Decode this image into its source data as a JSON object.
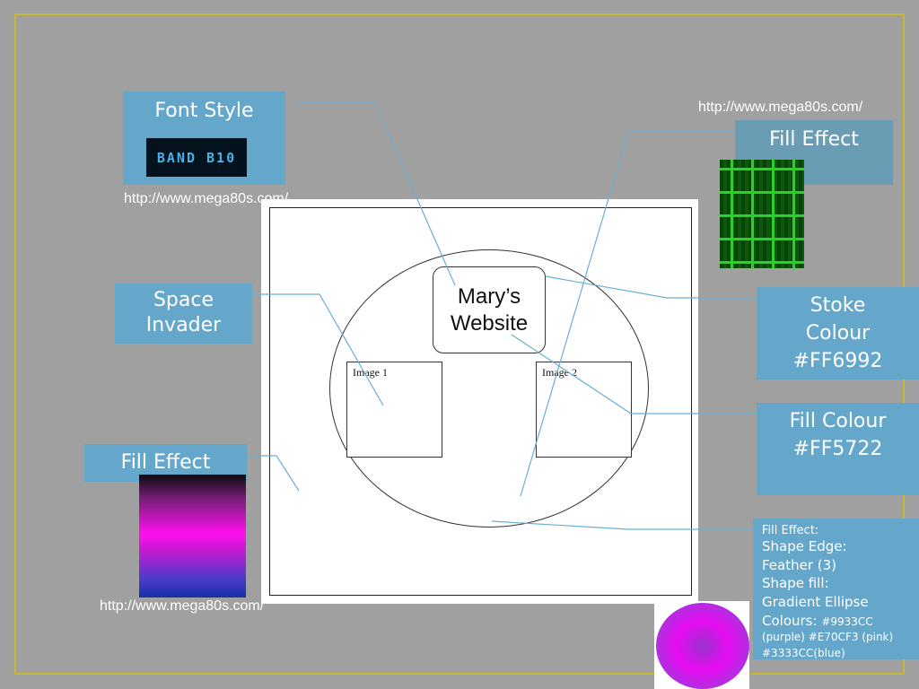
{
  "callouts": {
    "font_style": "Font Style",
    "fill_effect_top": "Fill Effect",
    "space_invader": "Space Invader",
    "fill_effect_left": "Fill Effect",
    "stroke_colour": "Stoke Colour #FF6992",
    "fill_colour": "Fill Colour #FF5722"
  },
  "band_text": "BAND B10",
  "urls": {
    "top_right": "http://www.mega80s.com/",
    "top_left": "http://www.mega80s.com/",
    "bottom_left": "http://www.mega80s.com/"
  },
  "mockup": {
    "title": "Mary’s Website",
    "image1": "Image 1",
    "image2": "Image 2"
  },
  "fill_effect_detail": {
    "heading": "Fill Effect:",
    "line1": "Shape Edge:",
    "line2": "Feather (3)",
    "line3": "Shape fill:",
    "line4": "Gradient Ellipse",
    "line5_label": "Colours:",
    "line5_value": "#9933CC",
    "line6": "(purple) #E70CF3 (pink)",
    "line7": "#3333CC(blue)"
  },
  "colors": {
    "background": "#a0a0a0",
    "callout": "#64a7cb",
    "frame": "#c9b92a",
    "leader": "#6aaed6",
    "purple": "#9933CC",
    "pink": "#E70CF3",
    "blue": "#3333CC"
  }
}
